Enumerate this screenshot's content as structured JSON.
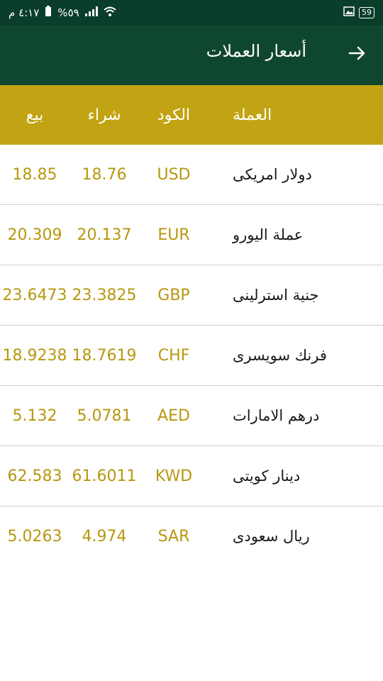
{
  "status": {
    "time": "٤:١٧ م",
    "battery": "%٥٩",
    "battery_badge": "59"
  },
  "appbar": {
    "title": "أسعار العملات"
  },
  "table": {
    "headers": {
      "currency": "العملة",
      "code": "الكود",
      "buy": "شراء",
      "sell": "بيع"
    },
    "rows": [
      {
        "currency": "دولار امريكى",
        "code": "USD",
        "buy": "18.76",
        "sell": "18.85"
      },
      {
        "currency": "عملة اليورو",
        "code": "EUR",
        "buy": "20.137",
        "sell": "20.309"
      },
      {
        "currency": "جنية استرلينى",
        "code": "GBP",
        "buy": "23.3825",
        "sell": "23.6473"
      },
      {
        "currency": "فرنك سويسرى",
        "code": "CHF",
        "buy": "18.7619",
        "sell": "18.9238"
      },
      {
        "currency": "درهم الامارات",
        "code": "AED",
        "buy": "5.0781",
        "sell": "5.132"
      },
      {
        "currency": "دينار كويتى",
        "code": "KWD",
        "buy": "61.6011",
        "sell": "62.583"
      },
      {
        "currency": "ريال سعودى",
        "code": "SAR",
        "buy": "4.974",
        "sell": "5.0263"
      }
    ]
  }
}
